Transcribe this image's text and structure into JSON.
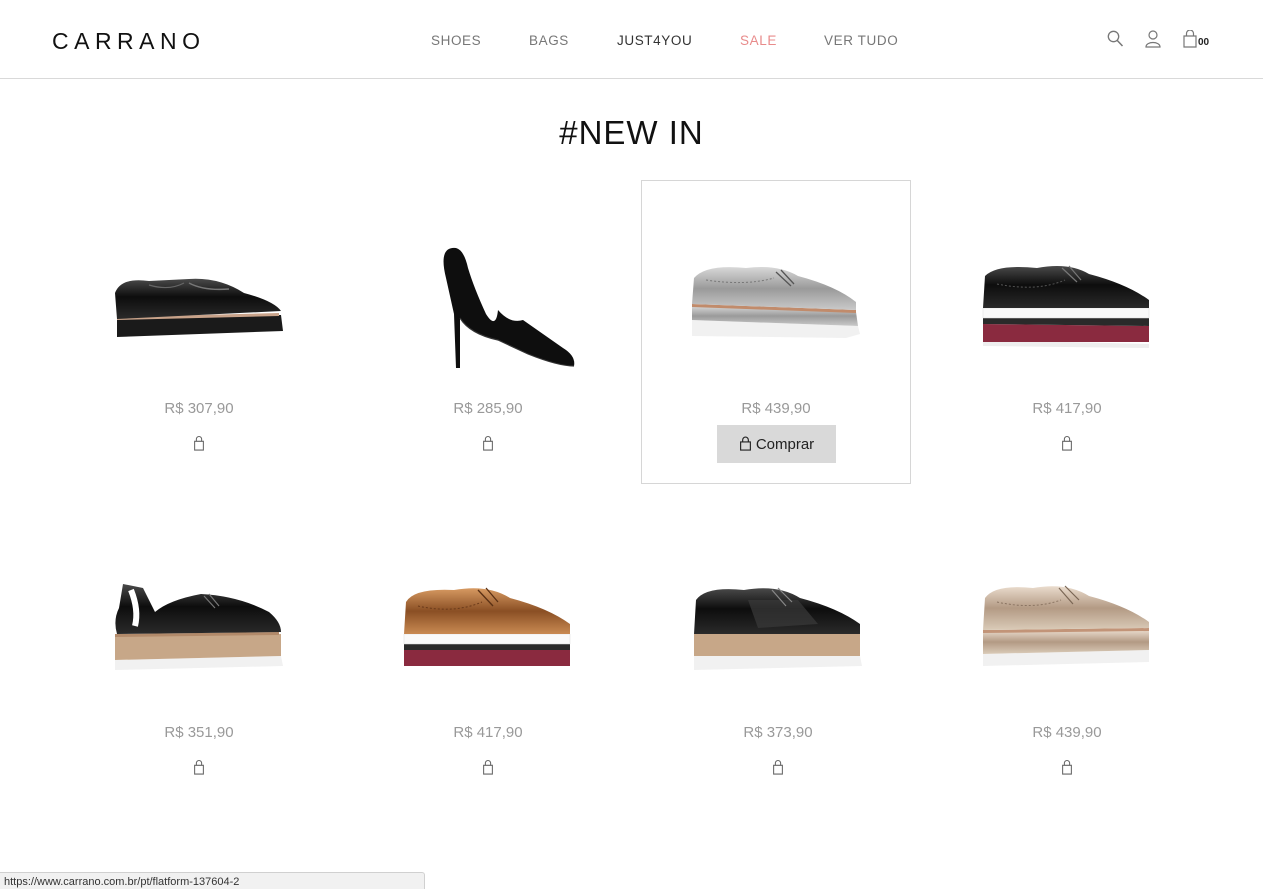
{
  "header": {
    "logo": "CARRANO",
    "nav": [
      {
        "label": "SHOES"
      },
      {
        "label": "BAGS"
      },
      {
        "label": "JUST4YOU"
      },
      {
        "label": "SALE"
      },
      {
        "label": "VER TUDO"
      }
    ],
    "icons": [
      "search-icon",
      "user-icon",
      "shopping-bag-icon"
    ],
    "cart_count": "00"
  },
  "page": {
    "title": "#NEW IN"
  },
  "products": [
    {
      "price": "R$ 307,90",
      "image": "black-patent-platform-slipon"
    },
    {
      "price": "R$ 285,90",
      "image": "black-suede-stiletto-pump"
    },
    {
      "price": "R$ 439,90",
      "image": "silver-metallic-platform-oxford",
      "buy_label": "Comprar"
    },
    {
      "price": "R$ 417,90",
      "image": "black-patent-striped-platform-oxford"
    },
    {
      "price": "R$ 351,90",
      "image": "black-patent-slingback-flatform"
    },
    {
      "price": "R$ 417,90",
      "image": "bronze-striped-platform-oxford"
    },
    {
      "price": "R$ 373,90",
      "image": "black-perforated-flatform-oxford"
    },
    {
      "price": "R$ 439,90",
      "image": "rose-gold-platform-oxford"
    }
  ],
  "colors": {
    "sale": "#e88b8b",
    "price": "#999999",
    "buy_button": "#d9d9d9"
  },
  "status_bar": {
    "url": "https://www.carrano.com.br/pt/flatform-137604-2"
  }
}
